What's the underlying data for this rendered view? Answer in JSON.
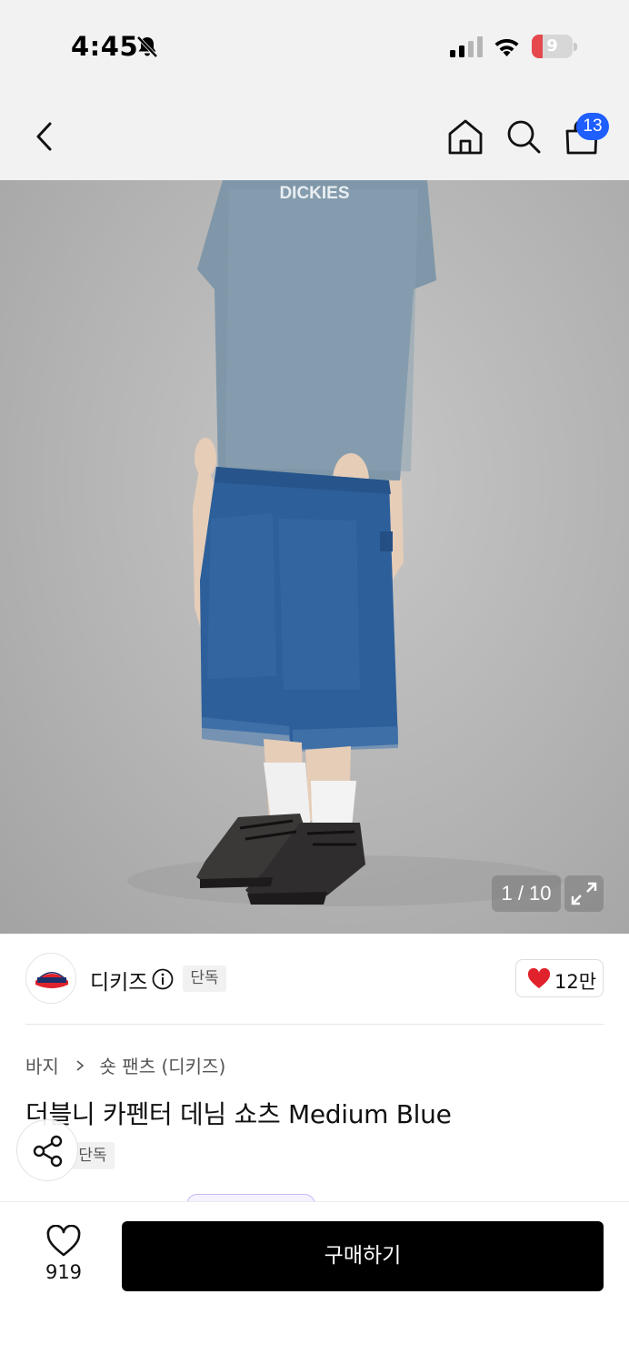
{
  "status_bar": {
    "time": "4:45",
    "battery_level": "9",
    "battery_percent": 9,
    "icons": [
      "bell-slash-icon",
      "cellular-signal-icon",
      "wifi-icon",
      "battery-icon"
    ]
  },
  "nav": {
    "icons": [
      "chevron-left-icon",
      "home-icon",
      "search-icon",
      "shopping-bag-icon"
    ],
    "cart_count": "13"
  },
  "hero": {
    "shirt_print": "DICKIES",
    "image_counter": "1 / 10",
    "colors": {
      "shirt": "#7f97a8",
      "denim": "#2d5f9a",
      "backdrop": "#b8b8b8"
    }
  },
  "brand": {
    "name": "디키즈",
    "exclusive_badge": "단독",
    "like_count": "12만",
    "logo_icon": "dickies-logo-icon",
    "accent_color": "#e0222c"
  },
  "product": {
    "breadcrumb": [
      "바지",
      "숏 팬츠 (디키즈)"
    ],
    "title": "더블니 카펜터 데님 쇼츠 Medium Blue",
    "badge": "단독"
  },
  "bottom_bar": {
    "wish_count": "919",
    "buy_label": "구매하기"
  }
}
